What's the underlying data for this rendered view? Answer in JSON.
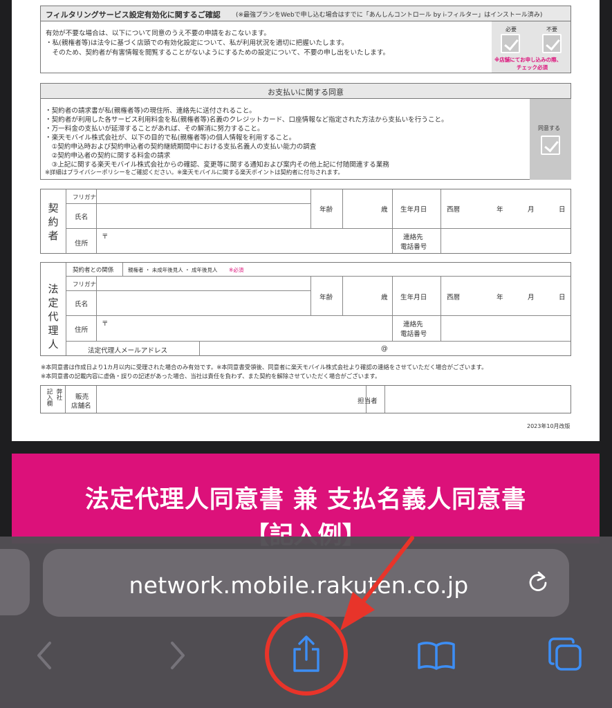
{
  "document": {
    "filtering": {
      "title": "フィルタリングサービス設定有効化に関するご確認",
      "title_note": "(※最強プランをWebで申し込む場合はすでに「あんしんコントロール by i-フィルター」はインストール済み)",
      "lines": [
        "有効が不要な場合は、以下について同意のうえ不要の申請をおこないます。",
        "・私(親権者等)は法令に基づく店頭での有効化設定について、私が利用状況を適切に把握いたします。",
        "　そのため、契約者が有害情報を閲覧することがないようにするための設定について、不要の申し出をいたします。"
      ],
      "check_required": "必要",
      "check_unneeded": "不要",
      "store_note_1": "※店舗にてお申し込みの際、",
      "store_note_2": "チェック必須"
    },
    "payment": {
      "title": "お支払いに関する同意",
      "lines": [
        "・契約者の請求書が私(親権者等)の現住所、連絡先に送付されること。",
        "・契約者が利用した各サービス利用料金を私(親権者等)名義のクレジットカード、口座情報など指定された方法から支払いを行うこと。",
        "・万一料金の支払いが延滞することがあれば、その解消に努力すること。",
        "・楽天モバイル株式会社が、以下の目的で私(親権者等)の個人情報を利用すること。",
        "　①契約申込時および契約申込者の契約継続期間中における支払名義人の支払い能力の調査",
        "　②契約申込者の契約に関する料金の請求",
        "　③上記に関する楽天モバイル株式会社からの確認、変更等に関する通知および案内その他上記に付随関連する業務",
        "※詳細はプライバシーポリシーをご確認ください。※楽天モバイルに関する楽天ポイントは契約者に付与されます。"
      ],
      "agree_label": "同意する"
    },
    "contractor": {
      "section_label": "契約者",
      "furigana": "フリガナ",
      "name": "氏名",
      "age": "年齢",
      "age_unit": "歳",
      "birthdate": "生年月日",
      "era": "西暦",
      "year": "年",
      "month": "月",
      "day": "日",
      "address": "住所",
      "postal": "〒",
      "phone_1": "連絡先",
      "phone_2": "電話番号"
    },
    "guardian": {
      "section_label": "法定代理人",
      "relation_label": "契約者との関係",
      "relation_options": "親権者 ・ 未成年後見人 ・ 成年後見人",
      "required_mark": "※必須",
      "furigana": "フリガナ",
      "name": "氏名",
      "age": "年齢",
      "age_unit": "歳",
      "birthdate": "生年月日",
      "era": "西暦",
      "year": "年",
      "month": "月",
      "day": "日",
      "address": "住所",
      "postal": "〒",
      "phone_1": "連絡先",
      "phone_2": "電話番号",
      "email_label": "法定代理人メールアドレス",
      "at_mark": "@"
    },
    "notes": [
      "※本同意書は作成日より1カ月以内に受理された場合のみ有効です。※本同意書受領後、同意者に楽天モバイル株式会社より確認の連絡をさせていただく場合がございます。",
      "※本同意書の記載内容に虚偽・誤りの記述があった場合、当社は責任を負わず、また契約を解除させていただく場合がございます。"
    ],
    "store": {
      "entry_label_1": "弊社",
      "entry_label_2": "記入欄",
      "shop_1": "販売",
      "shop_2": "店舗名",
      "staff": "担当者"
    },
    "revision": "2023年10月改版"
  },
  "banner": {
    "title": "法定代理人同意書 兼 支払名義人同意書",
    "subtitle": "【記入例】"
  },
  "browser": {
    "url": "network.mobile.rakuten.co.jp",
    "icons": {
      "reload": "reload-icon",
      "back": "back-chevron-icon",
      "forward": "forward-chevron-icon",
      "share": "share-icon",
      "bookmarks": "bookmarks-icon",
      "tabs": "tabs-icon"
    }
  },
  "colors": {
    "accent_pink": "#dc117a",
    "safari_blue": "#3d8ef4",
    "annotation_red": "#e8342a"
  }
}
